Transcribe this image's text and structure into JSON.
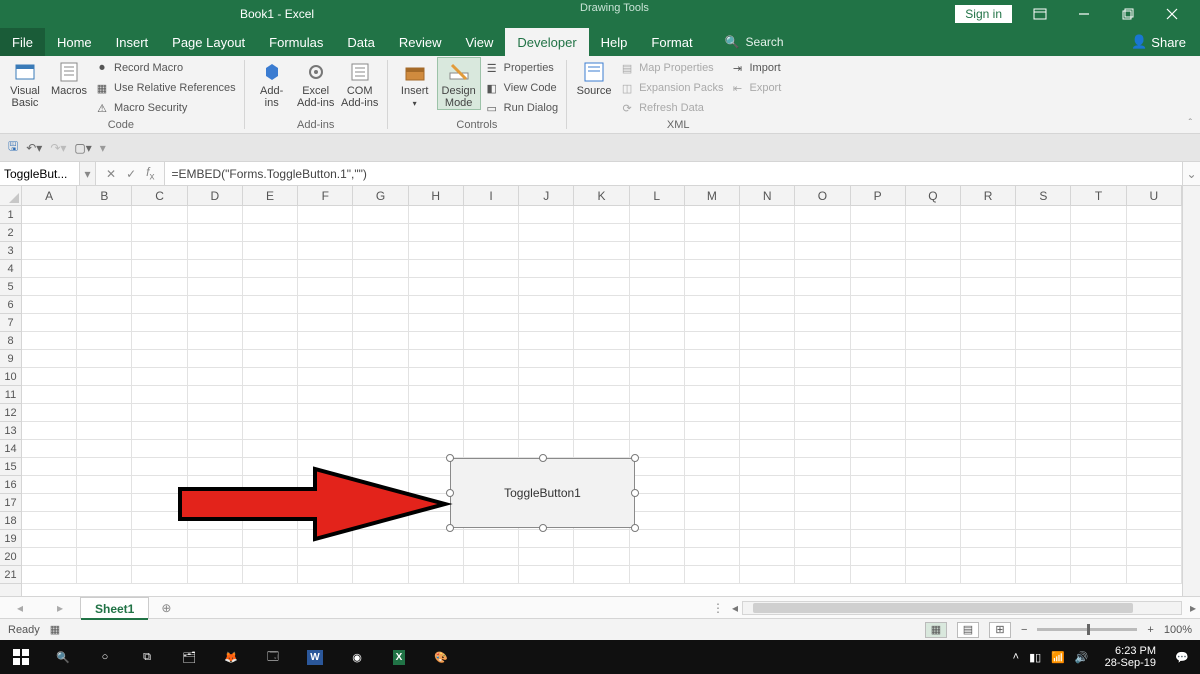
{
  "titlebar": {
    "docTitle": "Book1 - Excel",
    "contextTab": "Drawing Tools",
    "signIn": "Sign in"
  },
  "tabs": {
    "file": "File",
    "home": "Home",
    "insert": "Insert",
    "pageLayout": "Page Layout",
    "formulas": "Formulas",
    "data": "Data",
    "review": "Review",
    "view": "View",
    "developer": "Developer",
    "help": "Help",
    "format": "Format",
    "tellMe": "Search",
    "share": "Share"
  },
  "ribbon": {
    "code": {
      "visualBasic": "Visual\nBasic",
      "macros": "Macros",
      "recordMacro": "Record Macro",
      "useRelative": "Use Relative References",
      "macroSecurity": "Macro Security",
      "label": "Code"
    },
    "addins": {
      "addins": "Add-\nins",
      "excelAddins": "Excel\nAdd-ins",
      "comAddins": "COM\nAdd-ins",
      "label": "Add-ins"
    },
    "controls": {
      "insert": "Insert",
      "designMode": "Design\nMode",
      "properties": "Properties",
      "viewCode": "View Code",
      "runDialog": "Run Dialog",
      "label": "Controls"
    },
    "xml": {
      "source": "Source",
      "mapProps": "Map Properties",
      "expansion": "Expansion Packs",
      "refresh": "Refresh Data",
      "import": "Import",
      "export": "Export",
      "label": "XML"
    }
  },
  "formulaBar": {
    "name": "ToggleBut...",
    "formula": "=EMBED(\"Forms.ToggleButton.1\",\"\")"
  },
  "grid": {
    "cols": [
      "A",
      "B",
      "C",
      "D",
      "E",
      "F",
      "G",
      "H",
      "I",
      "J",
      "K",
      "L",
      "M",
      "N",
      "O",
      "P",
      "Q",
      "R",
      "S",
      "T",
      "U"
    ],
    "rows": [
      "1",
      "2",
      "3",
      "4",
      "5",
      "6",
      "7",
      "8",
      "9",
      "10",
      "11",
      "12",
      "13",
      "14",
      "15",
      "16",
      "17",
      "18",
      "19",
      "20",
      "21"
    ]
  },
  "embedded": {
    "label": "ToggleButton1"
  },
  "sheets": {
    "active": "Sheet1"
  },
  "status": {
    "ready": "Ready",
    "zoom": "100%"
  },
  "systemTray": {
    "time": "6:23 PM",
    "date": "28-Sep-19"
  }
}
